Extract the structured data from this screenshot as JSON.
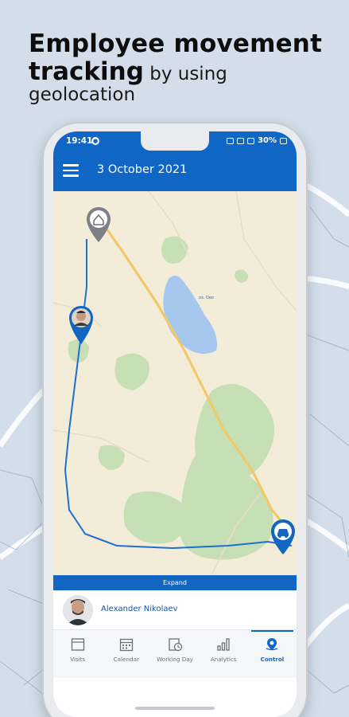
{
  "headline": {
    "line1": "Employee movement",
    "line2_bold": "tracking",
    "line2_rest": " by using",
    "line3": "geolocation"
  },
  "status_bar": {
    "time": "19:41",
    "battery": "30%"
  },
  "app_bar": {
    "title": "3 October 2021",
    "menu_icon": "hamburger-menu-icon"
  },
  "map": {
    "lake_label": "оз. Ово",
    "pins": [
      {
        "type": "home",
        "icon": "home-pin-icon"
      },
      {
        "type": "employee",
        "icon": "avatar-pin-icon"
      },
      {
        "type": "vehicle",
        "icon": "car-pin-icon"
      }
    ],
    "route_color": "#1f6fd1"
  },
  "panel": {
    "expand_label": "Expand"
  },
  "employee": {
    "name": "Alexander Nikolaev"
  },
  "bottom_nav": [
    {
      "label": "Visits",
      "icon": "visits-icon",
      "active": false
    },
    {
      "label": "Calendar",
      "icon": "calendar-icon",
      "active": false
    },
    {
      "label": "Working Day",
      "icon": "working-day-icon",
      "active": false
    },
    {
      "label": "Analytics",
      "icon": "analytics-icon",
      "active": false
    },
    {
      "label": "Control",
      "icon": "control-icon",
      "active": true
    }
  ],
  "colors": {
    "brand_blue": "#0f66c4",
    "background": "#d3deea",
    "map_base": "#f3ecd9",
    "map_green": "#c7dfb5",
    "water": "#a6c8ee",
    "road": "#f2c865"
  }
}
